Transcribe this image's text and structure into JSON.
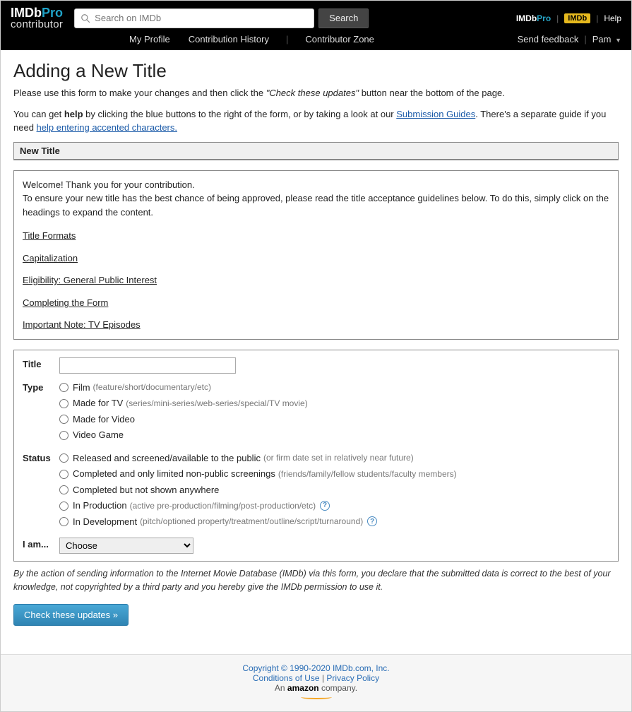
{
  "header": {
    "logo_main_a": "IMDb",
    "logo_main_b": "Pro",
    "logo_sub": "contributor",
    "search_placeholder": "Search on IMDb",
    "search_button": "Search",
    "pro_badge_a": "IMDb",
    "pro_badge_b": "Pro",
    "imdb_badge": "IMDb",
    "help": "Help"
  },
  "subnav": {
    "items": [
      "My Profile",
      "Contribution History",
      "Contributor Zone"
    ],
    "send_feedback": "Send feedback",
    "user": "Pam"
  },
  "page": {
    "title": "Adding a New Title",
    "intro1_a": "Please use this form to make your changes and then click the ",
    "intro1_italic": "\"Check these updates\"",
    "intro1_b": " button near the bottom of the page.",
    "intro2_a": "You can get ",
    "intro2_bold": "help",
    "intro2_b": " by clicking the blue buttons to the right of the form, or by taking a look at our ",
    "intro2_link1": "Submission Guides",
    "intro2_c": ". There's a separate guide if you need ",
    "intro2_link2": "help entering accented characters."
  },
  "section": {
    "new_title_header": "New Title",
    "welcome_line1": "Welcome! Thank you for your contribution.",
    "welcome_line2": "To ensure your new title has the best chance of being approved, please read the title acceptance guidelines below. To do this, simply click on the headings to expand the content.",
    "guidelines": [
      "Title Formats",
      "Capitalization",
      "Eligibility: General Public Interest",
      "Completing the Form",
      "Important Note: TV Episodes"
    ]
  },
  "form": {
    "title_label": "Title",
    "title_value": "",
    "type_label": "Type",
    "type_options": [
      {
        "label": "Film",
        "paren": "(feature/short/documentary/etc)"
      },
      {
        "label": "Made for TV",
        "paren": "(series/mini-series/web-series/special/TV movie)"
      },
      {
        "label": "Made for Video",
        "paren": ""
      },
      {
        "label": "Video Game",
        "paren": ""
      }
    ],
    "status_label": "Status",
    "status_options": [
      {
        "label": "Released and screened/available to the public",
        "paren": "(or firm date set in relatively near future)",
        "help": false
      },
      {
        "label": "Completed and only limited non-public screenings",
        "paren": "(friends/family/fellow students/faculty members)",
        "help": false
      },
      {
        "label": "Completed but not shown anywhere",
        "paren": "",
        "help": false
      },
      {
        "label": "In Production",
        "paren": "(active pre-production/filming/post-production/etc)",
        "help": true
      },
      {
        "label": "In Development",
        "paren": "(pitch/optioned property/treatment/outline/script/turnaround)",
        "help": true
      }
    ],
    "iam_label": "I am...",
    "iam_selected": "Choose"
  },
  "disclaimer": "By the action of sending information to the Internet Movie Database (IMDb) via this form, you declare that the submitted data is correct to the best of your knowledge, not copyrighted by a third party and you hereby give the IMDb permission to use it.",
  "check_button": "Check these updates »",
  "footer": {
    "copyright": "Copyright © 1990-2020 IMDb.com, Inc.",
    "conditions": "Conditions of Use",
    "privacy": "Privacy Policy",
    "an": "An ",
    "amazon": "amazon",
    "company": " company."
  }
}
